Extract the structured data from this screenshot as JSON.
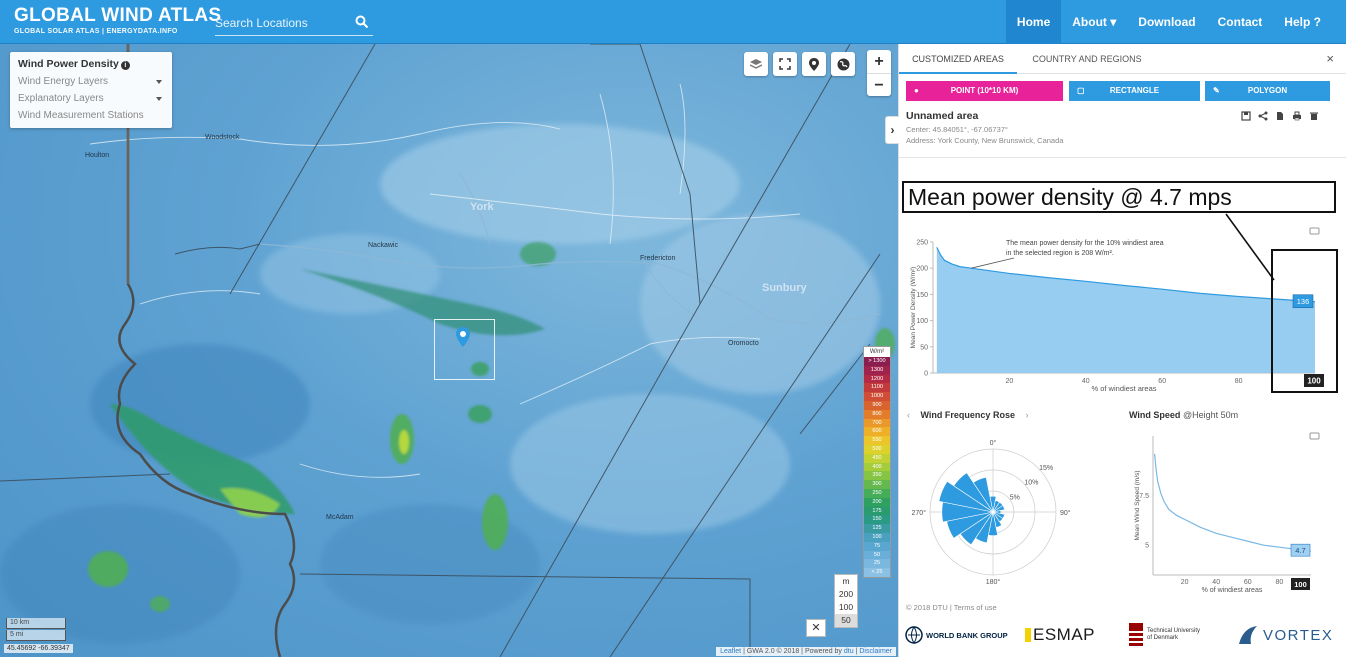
{
  "brand": {
    "title": "GLOBAL WIND ATLAS",
    "subtitle": "GLOBAL SOLAR ATLAS | ENERGYDATA.INFO"
  },
  "search": {
    "placeholder": "Search Locations"
  },
  "nav": [
    {
      "label": "Home",
      "active": true
    },
    {
      "label": "About",
      "dropdown": true
    },
    {
      "label": "Download"
    },
    {
      "label": "Contact"
    },
    {
      "label": "Help"
    }
  ],
  "layer_panel": {
    "title": "Wind Power Density",
    "items": [
      "Wind Energy Layers",
      "Explanatory Layers",
      "Wind Measurement Stations"
    ]
  },
  "map": {
    "place_labels": [
      "Woodstock",
      "Houlton",
      "York",
      "Fredericton",
      "Nackawic",
      "Sunbury",
      "Oromocto",
      "McAdam"
    ],
    "legend_unit": "W/m²",
    "legend_levels": [
      "> 1300",
      "1300",
      "1200",
      "1100",
      "1000",
      "900",
      "800",
      "700",
      "600",
      "550",
      "500",
      "450",
      "400",
      "350",
      "300",
      "250",
      "200",
      "175",
      "150",
      "125",
      "100",
      "75",
      "50",
      "25",
      "< 25"
    ],
    "legend_colors": [
      "#8a1e4f",
      "#a0234d",
      "#b32a44",
      "#c23a3a",
      "#cf4e35",
      "#d9632f",
      "#e37d2c",
      "#eb982a",
      "#efb029",
      "#ecc52a",
      "#dcd12d",
      "#c2d234",
      "#a5cd3b",
      "#86c444",
      "#64b84d",
      "#45ac57",
      "#2fa060",
      "#2a9a6f",
      "#2a9a84",
      "#3a9ca2",
      "#4aa0be",
      "#59a6d0",
      "#69afd9",
      "#7ab8df",
      "#8ac1e5"
    ],
    "height_options": [
      "m",
      "200",
      "100",
      "50"
    ],
    "height_selected": "50",
    "scale_labels": [
      "10 km",
      "5 mi"
    ],
    "coords": "45.45692 -66.39347",
    "attribution": [
      "Leaflet",
      "GWA 2.0 © 2018",
      "Powered by",
      "dtu",
      "Disclaimer"
    ]
  },
  "panel": {
    "tabs": [
      "CUSTOMIZED AREAS",
      "COUNTRY AND REGIONS"
    ],
    "modes": [
      "POINT (10*10 KM)",
      "RECTANGLE",
      "POLYGON"
    ],
    "area_title": "Unnamed area",
    "center": "Center: 45.84051°, -67.06737°",
    "address": "Address: York County, New Brunswick, Canada",
    "callout": "Mean power density @ 4.7 mps",
    "footer": "© 2018  DTU  |  Terms of use",
    "logos": {
      "worldbank": "WORLD BANK GROUP",
      "esmap": "ESMAP",
      "dtu_line1": "Technical University",
      "dtu_line2": "of Denmark",
      "vortex": "VORTEX"
    }
  },
  "colors": {
    "nav_bg": "#2e9ae0",
    "point_mode": "#e8239a",
    "mode_btn": "#2e9ae0",
    "chart_fill": "#8cc8f0",
    "chart_line": "#2e9ae0",
    "rose_fill": "#2e9ae0"
  },
  "chart_data": [
    {
      "type": "area",
      "title": "",
      "xlabel": "% of windiest areas",
      "ylabel": "Mean Power Density (W/m²)",
      "xlim": [
        0,
        100
      ],
      "ylim": [
        0,
        250
      ],
      "xticks": [
        "20",
        "40",
        "60",
        "80",
        "100"
      ],
      "yticks": [
        "0",
        "50",
        "100",
        "150",
        "200",
        "250"
      ],
      "x": [
        1,
        2,
        3,
        5,
        7,
        10,
        15,
        20,
        30,
        40,
        50,
        60,
        70,
        80,
        90,
        100
      ],
      "y": [
        240,
        225,
        215,
        208,
        203,
        200,
        195,
        190,
        182,
        175,
        167,
        160,
        152,
        146,
        141,
        136
      ],
      "annotation": "The mean power density for the 10% windiest area in the selected region is 208 W/m².",
      "end_label": "136",
      "highlight_label": "100"
    },
    {
      "type": "rose",
      "title": "Wind Frequency Rose",
      "direction_labels": [
        "0°",
        "90°",
        "180°",
        "270°"
      ],
      "ring_labels": [
        "5%",
        "10%",
        "15%"
      ],
      "sectors": [
        4,
        3,
        3,
        3,
        2,
        3,
        3,
        4,
        6,
        8,
        10,
        12,
        13,
        14,
        12,
        9
      ]
    },
    {
      "type": "line",
      "title": "Wind Speed",
      "subtitle": "@Height 50m",
      "xlabel": "% of windiest areas",
      "ylabel": "Mean Wind Speed (m/s)",
      "xlim": [
        0,
        100
      ],
      "ylim": [
        3.5,
        10.5
      ],
      "xticks": [
        "20",
        "40",
        "60",
        "80",
        "100"
      ],
      "yticks": [
        "5",
        "7.5"
      ],
      "x": [
        1,
        2,
        3,
        5,
        7,
        10,
        15,
        20,
        30,
        40,
        50,
        60,
        70,
        80,
        90,
        100
      ],
      "y": [
        9.6,
        8.8,
        8.2,
        7.6,
        7.2,
        6.8,
        6.5,
        6.3,
        5.9,
        5.6,
        5.4,
        5.2,
        5.0,
        4.9,
        4.8,
        4.7
      ],
      "end_label": "4.7",
      "highlight_label": "100"
    }
  ]
}
